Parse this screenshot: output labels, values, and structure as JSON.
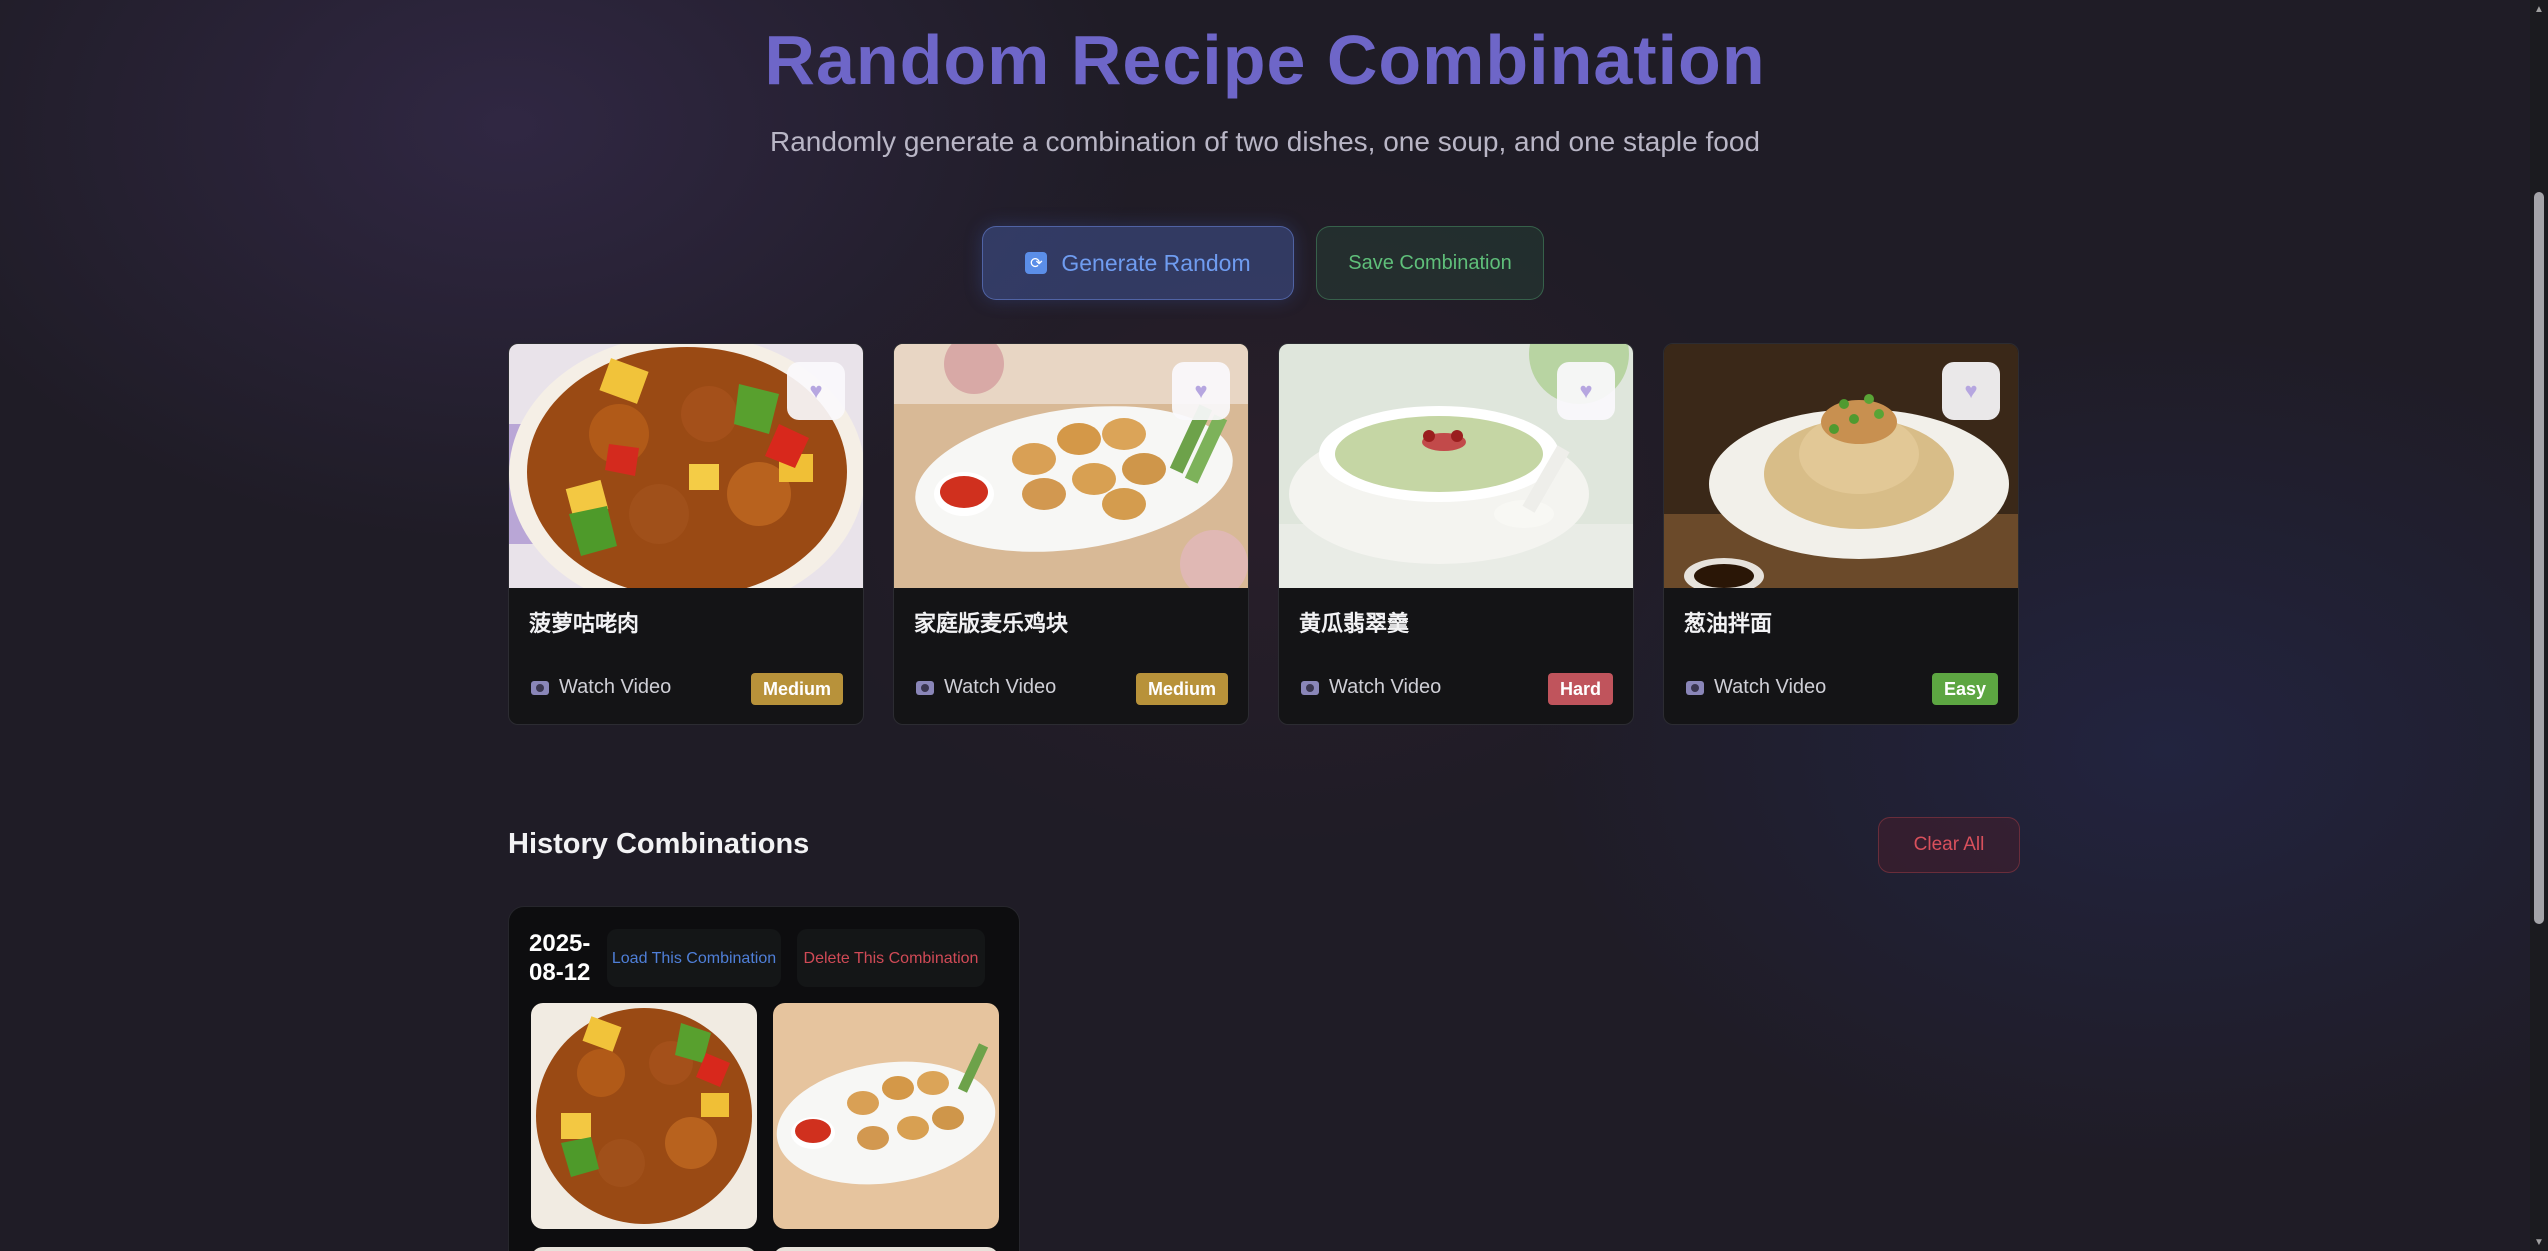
{
  "header": {
    "title": "Random Recipe Combination",
    "subtitle": "Randomly generate a combination of two dishes, one soup, and one staple food"
  },
  "actions": {
    "generate_label": "Generate Random",
    "generate_icon": "refresh-icon",
    "save_label": "Save Combination"
  },
  "cards": [
    {
      "name": "菠萝咕咾肉",
      "video_label": "Watch Video",
      "difficulty": "Medium",
      "difficulty_color": "#b8923a",
      "image": "sweet-and-sour-pork-photo"
    },
    {
      "name": "家庭版麦乐鸡块",
      "video_label": "Watch Video",
      "difficulty": "Medium",
      "difficulty_color": "#b8923a",
      "image": "chicken-nuggets-photo"
    },
    {
      "name": "黄瓜翡翠羹",
      "video_label": "Watch Video",
      "difficulty": "Hard",
      "difficulty_color": "#c0545c",
      "image": "cucumber-soup-photo"
    },
    {
      "name": "葱油拌面",
      "video_label": "Watch Video",
      "difficulty": "Easy",
      "difficulty_color": "#5da642",
      "image": "scallion-oil-noodles-photo"
    }
  ],
  "history": {
    "title": "History Combinations",
    "clear_label": "Clear All",
    "entries": [
      {
        "date": "2025-08-12",
        "load_label": "Load This Combination",
        "delete_label": "Delete This Combination"
      }
    ]
  },
  "colors": {
    "title": "#6e66c8",
    "generate": "#6f9cf0",
    "save": "#5fbf7a",
    "clear": "#d8505c"
  }
}
